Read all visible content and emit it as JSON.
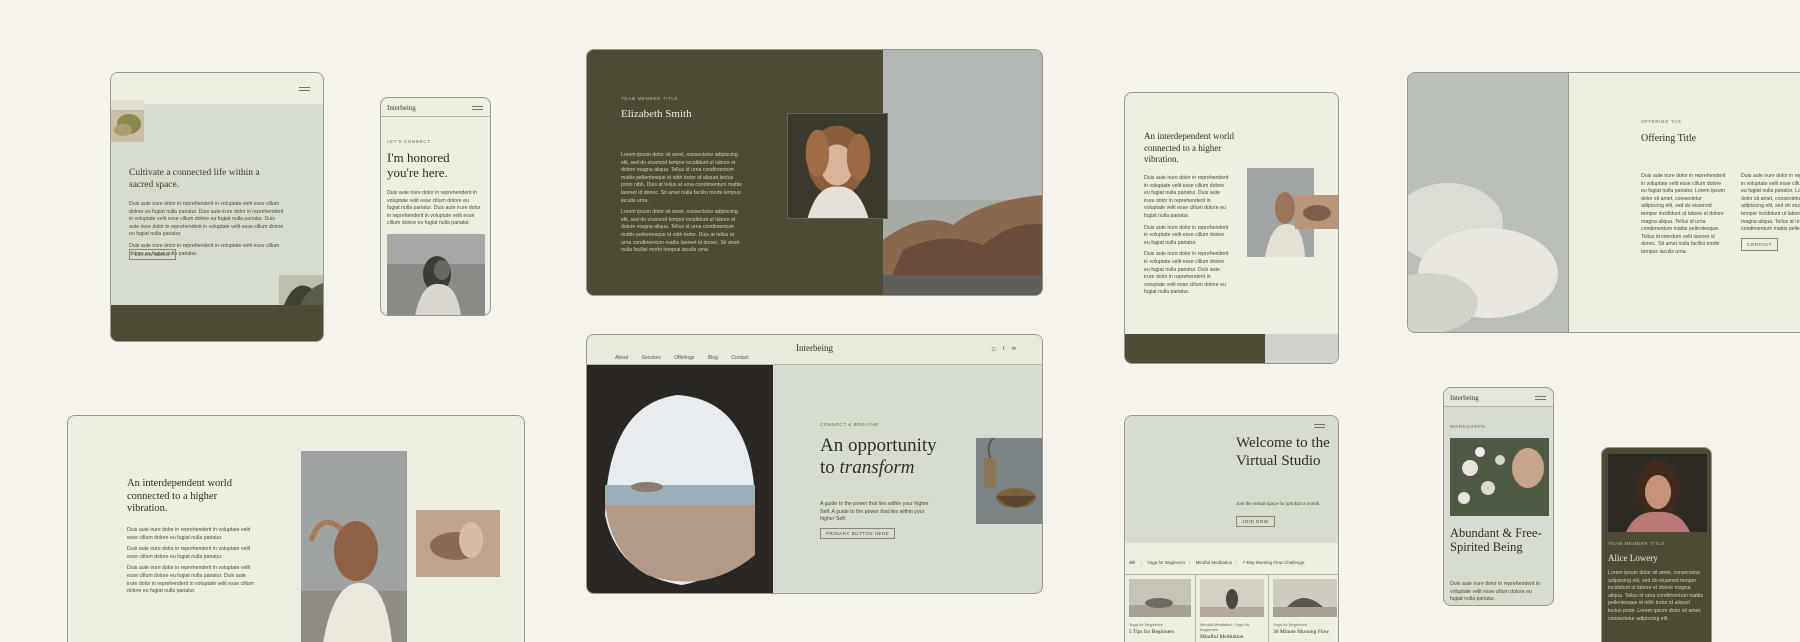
{
  "card_a": {
    "heading": "Cultivate a connected life within a sacred space.",
    "para1": "Duis aute irure dolor in reprehenderit in voluptate velit esse cillum dolore eu fugiat nulla pariatur. Duis aute irure dolor in reprehenderit in voluptate velit esse cillum dolore eu fugiat nulla pariatur. Duis aute irure dolor in reprehenderit in voluptate velit esse cillum dolore eu fugiat nulla pariatur.",
    "para2": "Duis aute irure dolor in reprehenderit in voluptate velit esse cillum dolore eu fugiat nulla pariatur.",
    "button": "Learn more"
  },
  "card_b": {
    "logo": "Interbeing",
    "eyebrow": "Let's connect",
    "heading": "I'm honored you're here.",
    "para": "Duis aute irure dolor in reprehenderit in voluptate velit esse cillum dolore eu fugiat nulla pariatur. Duis aute irure dolor in reprehenderit in voluptate velit esse cillum dolore eu fugiat nulla pariatur."
  },
  "card_c": {
    "eyebrow": "Team member title",
    "name": "Elizabeth Smith",
    "para1": "Lorem ipsum dolor sit amet, consectetur adipiscing elit, sed do eiusmod tempor incididunt ut labore et dolore magna aliqua. Tellus id urna condimentum mattis pellentesque id nibh tortor id aliquet lectus proin nibh. Duis at tellus at urna condimentum mattis laoreet id donec. Sit amet nulla facilisi morbi tempus iaculis urna.",
    "para2": "Lorem ipsum dolor sit amet, consectetur adipiscing elit, sed do eiusmod tempor incididunt ut labore et dolore magna aliqua. Tellus id urna condimentum mattis pellentesque id nibh tortor. Duis at tellus at urna condimentum mattis laoreet id donec. Sit amet nulla facilisi morbi tempus iaculis urna."
  },
  "card_d": {
    "heading": "An interdependent world connected to a higher vibration.",
    "para1": "Duis aute irure dolor in reprehenderit in voluptate velit esse cillum dolore eu fugiat nulla pariatur. Duis aute irure dolor in reprehenderit in voluptate velit esse cillum dolore eu fugiat nulla pariatur.",
    "para2": "Duis aute irure dolor in reprehenderit in voluptate velit esse cillum dolore eu fugiat nulla pariatur.",
    "para3": "Duis aute irure dolor in reprehenderit in voluptate velit esse cillum dolore eu fugiat nulla pariatur. Duis aute irure dolor in reprehenderit in voluptate velit esse cillum dolore eu fugiat nulla pariatur."
  },
  "card_e": {
    "eyebrow": "Offering tag",
    "title": "Offering Title",
    "para1": "Duis aute irure dolor in reprehenderit in voluptate velit esse cillum dolore eu fugiat nulla pariatur. Lorem ipsum dolor sit amet, consectetur adipiscing elit, sed do eiusmod tempor incididunt ut labore et dolore magna aliqua. Tellus id urna condimentum mattis pellentesque. Tellus id interdum velit laoreet id donec. Sit amet nulla facilisi morbi tempus iaculis urna.",
    "para2": "Duis aute irure dolor in reprehenderit in voluptate velit esse cillum dolore eu fugiat nulla pariatur. Lorem ipsum dolor sit amet, consectetur adipiscing elit, sed do eiusmod tempor incididunt ut labore et dolore magna aliqua. Tellus id urna condimentum mattis pellentesque.",
    "button": "Contact"
  },
  "card_f": {
    "heading": "An interdependent world connected to a higher vibration.",
    "para1": "Duis aute irure dolor in reprehenderit in voluptate velit esse cillum dolore eu fugiat nulla pariatur.",
    "para2": "Duis aute irure dolor in reprehenderit in voluptate velit esse cillum dolore eu fugiat nulla pariatur.",
    "para3": "Duis aute irure dolor in reprehenderit in voluptate velit esse cillum dolore eu fugiat nulla pariatur. Duis aute irure dolor in reprehenderit in voluptate velit esse cillum dolore eu fugiat nulla pariatur."
  },
  "card_g": {
    "nav": [
      "About",
      "Services",
      "Offerings",
      "Blog",
      "Contact"
    ],
    "logo": "Interbeing",
    "social": [
      "instagram-icon",
      "facebook-icon",
      "email-icon"
    ],
    "eyebrow": "Connect & breathe",
    "heading_1": "An opportunity",
    "heading_2": "to",
    "heading_em": "transform",
    "para": "A guide to the power that lies within your higher Self. A guide to the power that lies within your higher Self.",
    "button": "Primary button here"
  },
  "card_h": {
    "heading": "Welcome to the Virtual Studio",
    "sub": "Join the virtual space for just $10 a month.",
    "button": "Join now",
    "filters": [
      "All",
      "Yoga for Beginners",
      "Mindful Meditation",
      "7-Day Morning Flow Challenge"
    ],
    "items": [
      {
        "tag": "Yoga for Beginners",
        "title": "5 Tips for Beginners"
      },
      {
        "tag": "Mindful Meditation, Yoga for Beginners",
        "title": "Mindful Meditation"
      },
      {
        "tag": "Yoga for Beginners",
        "title": "30 Minute Morning Flow"
      }
    ]
  },
  "card_i": {
    "logo": "Interbeing",
    "eyebrow": "Workshops",
    "heading": "Abundant & Free-Spirited Being",
    "para": "Duis aute irure dolor in reprehenderit in voluptate velit esse cillum dolore eu fugiat nulla pariatur."
  },
  "card_j": {
    "eyebrow": "Team member title",
    "name": "Alice Lowery",
    "para": "Lorem ipsum dolor sit amet, consectetur adipiscing elit, sed do eiusmod tempor incididunt ut labore et dolore magna aliqua. Tellus id urna condimentum mattis pellentesque id nibh tortor id aliquet lectus proin. Lorem ipsum dolor sit amet, consectetur adipiscing elit."
  },
  "colors": {
    "background": "#f6f3ec",
    "olive": "#4d4a36",
    "sage": "#d6dccf",
    "cream": "#eeede1"
  }
}
